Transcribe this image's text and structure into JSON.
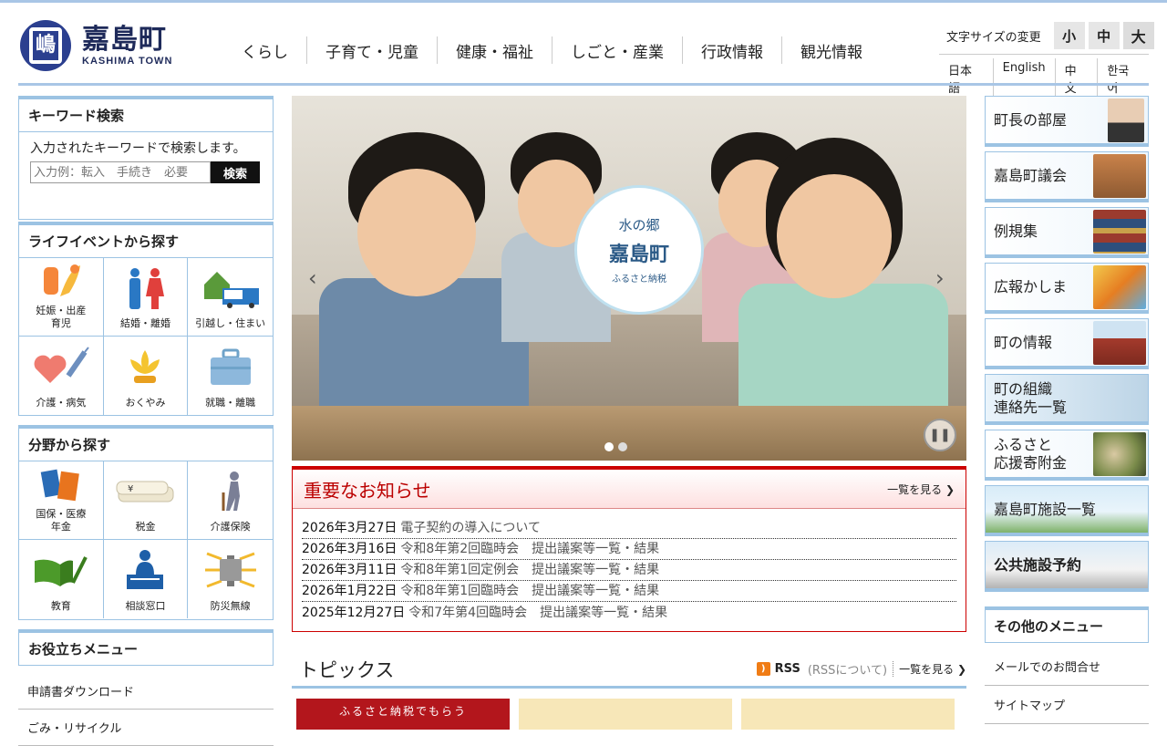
{
  "logo": {
    "name": "嘉島町",
    "en": "KASHIMA TOWN",
    "mark_char": "嶋"
  },
  "gnav": [
    "くらし",
    "子育て・児童",
    "健康・福祉",
    "しごと・産業",
    "行政情報",
    "観光情報"
  ],
  "textsize": {
    "label": "文字サイズの変更",
    "small": "小",
    "medium": "中",
    "large": "大"
  },
  "langs": [
    "日本語",
    "English",
    "中文",
    "한국어"
  ],
  "keyword": {
    "title": "キーワード検索",
    "desc": "入力されたキーワードで検索します。",
    "placeholder": "入力例：転入　手続き　必要",
    "button": "検索"
  },
  "life": {
    "title": "ライフイベントから探す",
    "items": [
      {
        "label": "妊娠・出産\n育児",
        "icon": "baby-bottle-icon"
      },
      {
        "label": "結婚・離婚",
        "icon": "couple-icon"
      },
      {
        "label": "引越し・住まい",
        "icon": "house-truck-icon"
      },
      {
        "label": "介護・病気",
        "icon": "heart-syringe-icon"
      },
      {
        "label": "おくやみ",
        "icon": "lotus-icon"
      },
      {
        "label": "就職・離職",
        "icon": "briefcase-icon"
      }
    ]
  },
  "field": {
    "title": "分野から探す",
    "items": [
      {
        "label": "国保・医療\n年金",
        "icon": "pension-book-icon"
      },
      {
        "label": "税金",
        "icon": "tax-icon"
      },
      {
        "label": "介護保険",
        "icon": "elderly-icon"
      },
      {
        "label": "教育",
        "icon": "book-pen-icon"
      },
      {
        "label": "相談窓口",
        "icon": "counter-icon"
      },
      {
        "label": "防災無線",
        "icon": "speaker-icon"
      }
    ]
  },
  "useful": {
    "title": "お役立ちメニュー",
    "items": [
      "申請書ダウンロード",
      "ごみ・リサイクル"
    ]
  },
  "slider": {
    "badge_top": "水の郷",
    "badge_main": "嘉島町",
    "badge_sub": "ふるさと納税"
  },
  "notice": {
    "title": "重要なお知らせ",
    "more": "一覧を見る ❯",
    "items": [
      {
        "date": "2026年3月27日",
        "text": "電子契約の導入について"
      },
      {
        "date": "2026年3月16日",
        "text": "令和8年第2回臨時会　提出議案等一覧・結果"
      },
      {
        "date": "2026年3月11日",
        "text": "令和8年第1回定例会　提出議案等一覧・結果"
      },
      {
        "date": "2026年1月22日",
        "text": "令和8年第1回臨時会　提出議案等一覧・結果"
      },
      {
        "date": "2025年12月27日",
        "text": "令和7年第4回臨時会　提出議案等一覧・結果"
      }
    ]
  },
  "topics": {
    "title": "トピックス",
    "rss": "RSS",
    "rss_about": "(RSSについて)",
    "more": "一覧を見る ❯",
    "thumb1": "ふるさと納税でもらう"
  },
  "banners": [
    "町長の部屋",
    "嘉島町議会",
    "例規集",
    "広報かしま",
    "町の情報",
    "町の組織\n連絡先一覧",
    "ふるさと\n応援寄附金",
    "嘉島町施設一覧",
    "公共施設予約"
  ],
  "other": {
    "title": "その他のメニュー",
    "items": [
      "メールでのお問合せ",
      "サイトマップ"
    ]
  },
  "colors": {
    "accent": "#9cc3e3",
    "notice_red": "#cc0000",
    "logo_navy": "#2b3f8f"
  }
}
